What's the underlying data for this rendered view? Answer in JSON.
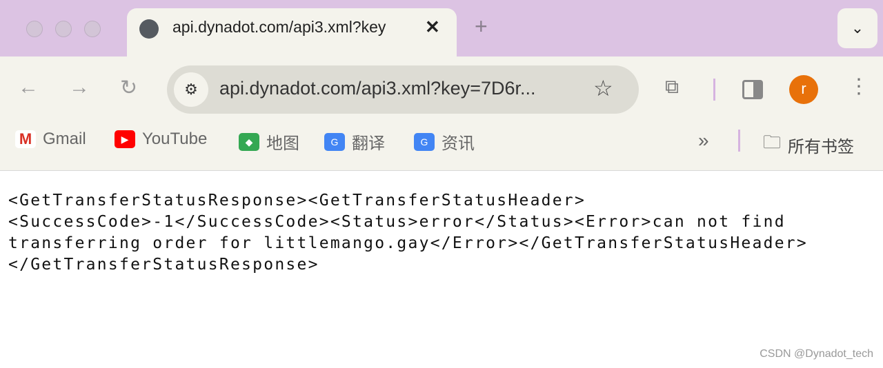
{
  "tab": {
    "title": "api.dynadot.com/api3.xml?key",
    "close": "✕",
    "icon": "globe-icon"
  },
  "new_tab": "+",
  "tab_menu": "⌄",
  "toolbar": {
    "back": "←",
    "forward": "→",
    "reload": "↻",
    "url": "api.dynadot.com/api3.xml?key=7D6r...",
    "star": "☆",
    "extensions": "⧉",
    "menu": "⋮",
    "avatar_letter": "r",
    "avatar_color": "#e8710a"
  },
  "bookmarks": [
    {
      "label": "Gmail",
      "icon": "gmail-icon"
    },
    {
      "label": "YouTube",
      "icon": "youtube-icon"
    },
    {
      "label": "地图",
      "icon": "maps-icon"
    },
    {
      "label": "翻译",
      "icon": "translate-icon"
    },
    {
      "label": "资讯",
      "icon": "news-icon"
    }
  ],
  "bookmarks_overflow": "»",
  "all_bookmarks": "所有书签",
  "content": {
    "lines": [
      "<GetTransferStatusResponse><GetTransferStatusHeader>",
      "<SuccessCode>-1</SuccessCode><Status>error</Status><Error>can not find",
      "transferring order for littlemango.gay</Error></GetTransferStatusHeader>",
      "</GetTransferStatusResponse>"
    ]
  },
  "watermark": "CSDN @Dynadot_tech"
}
